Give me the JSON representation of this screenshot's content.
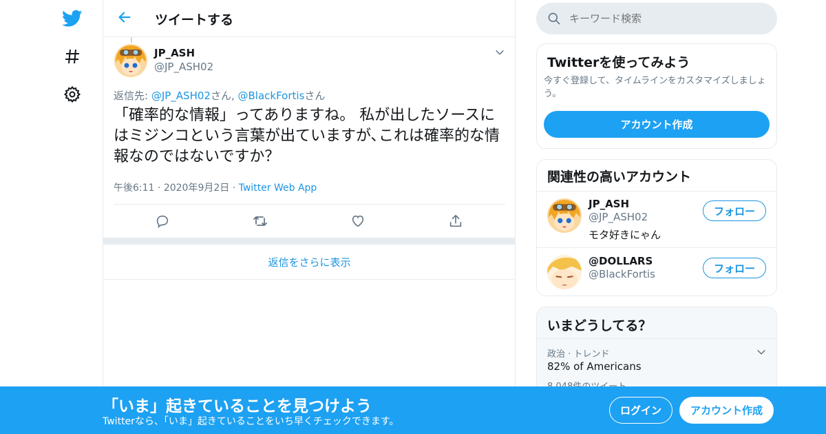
{
  "header": {
    "title": "ツイートする"
  },
  "tweet": {
    "author_name": "JP_ASH",
    "author_handle": "@JP_ASH02",
    "reply_prefix": "返信先: ",
    "reply_to_1": "@JP_ASH02",
    "reply_suffix_1": "さん, ",
    "reply_to_2": "@BlackFortis",
    "reply_suffix_2": "さん",
    "body": "「確率的な情報」ってありますね。 私が出したソースにはミジンコという言葉が出ていますが､これは確率的な情報なのではないですか？",
    "time": "午後6:11",
    "sep1": "·",
    "date": "2020年9月2日",
    "sep2": "·",
    "source": "Twitter Web App"
  },
  "more_replies": "返信をさらに表示",
  "search": {
    "placeholder": "キーワード検索"
  },
  "signup_card": {
    "title": "Twitterを使ってみよう",
    "desc": "今すぐ登録して、タイムラインをカスタマイズしましょう。",
    "button": "アカウント作成"
  },
  "related_card": {
    "title": "関連性の高いアカウント",
    "accounts": [
      {
        "name": "JP_ASH",
        "handle": "@JP_ASH02",
        "bio": "モタ好きにゃん",
        "follow": "フォロー"
      },
      {
        "name": "@DOLLARS",
        "handle": "@BlackFortis",
        "bio": "",
        "follow": "フォロー"
      }
    ]
  },
  "trends_card": {
    "title": "いまどうしてる？",
    "trend_context": "政治 · トレンド",
    "trend_name": "82% of Americans",
    "trend_count": "8,048件のツイート"
  },
  "banner": {
    "headline": "「いま」起きていることを見つけよう",
    "sub": "Twitterなら、「いま」起きていることをいち早くチェックできます。",
    "login": "ログイン",
    "signup": "アカウント作成"
  },
  "colors": {
    "accent": "#1b95e0",
    "banner": "#1da1f2"
  },
  "icons": [
    "twitter-bird-icon",
    "hashtag-icon",
    "gear-icon",
    "back-arrow-icon",
    "chevron-down-icon",
    "reply-icon",
    "retweet-icon",
    "like-icon",
    "share-icon",
    "search-icon"
  ]
}
